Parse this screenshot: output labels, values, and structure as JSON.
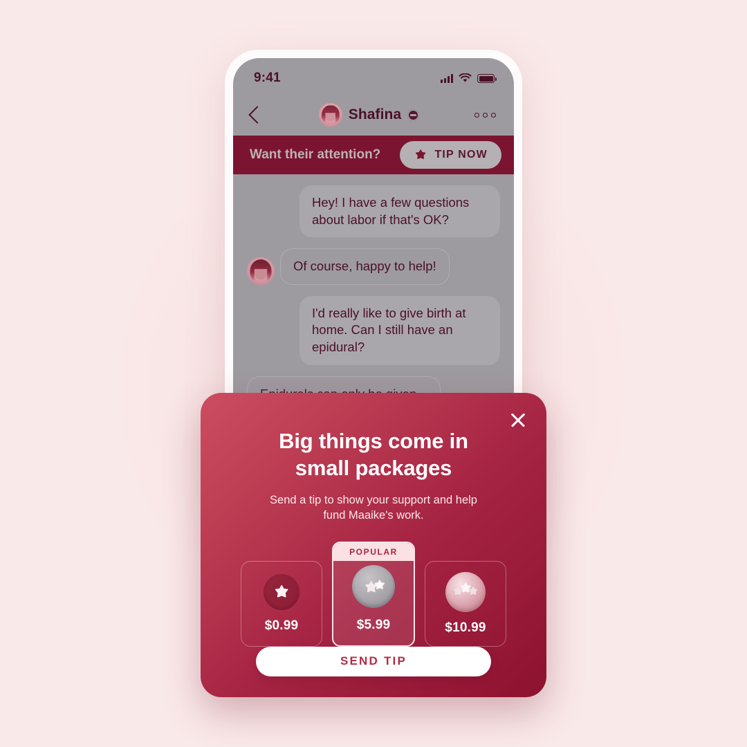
{
  "phone": {
    "status_bar": {
      "time": "9:41",
      "signal_icon": "signal-bars-icon",
      "wifi_icon": "wifi-icon",
      "battery_icon": "battery-full-icon"
    },
    "nav": {
      "back_icon": "chevron-left-icon",
      "avatar": "user-avatar",
      "name": "Shafina",
      "verified_icon": "verified-badge-icon",
      "more_icon": "more-options-icon"
    },
    "tip_banner": {
      "text": "Want their attention?",
      "button_label": "TIP NOW",
      "button_icon": "star-icon"
    },
    "chat": {
      "messages": [
        {
          "from": "outgoing",
          "text": "Hey! I have a few questions about labor if that's OK?",
          "avatar": false
        },
        {
          "from": "incoming",
          "text": "Of course, happy to help!",
          "avatar": true
        },
        {
          "from": "outgoing",
          "text": "I'd really like to give birth at home. Can I still have an epidural?",
          "avatar": false
        },
        {
          "from": "incoming",
          "text": "Epidurals can only be given in a hospital. However, you should",
          "avatar": false
        }
      ]
    }
  },
  "modal": {
    "close_icon": "close-icon",
    "title": "Big things come in small packages",
    "subtitle": "Send a tip to show your support and help fund Maaike's work.",
    "popular_label": "POPULAR",
    "tiers": [
      {
        "price": "$0.99",
        "coin": "single-star-coin",
        "selected": false,
        "popular": false
      },
      {
        "price": "$5.99",
        "coin": "double-star-coin",
        "selected": true,
        "popular": true
      },
      {
        "price": "$10.99",
        "coin": "triple-star-coin",
        "selected": false,
        "popular": false
      }
    ],
    "cta_label": "SEND TIP"
  },
  "colors": {
    "page_background": "#fae9e9",
    "modal_gradient_start": "#cc4d60",
    "modal_gradient_end": "#8d1230",
    "banner_wine": "#7b1430",
    "screen_overlay_grey": "#9e9ba0",
    "cta_text": "#b32b45",
    "popular_badge_bg": "#fbe0e4"
  }
}
